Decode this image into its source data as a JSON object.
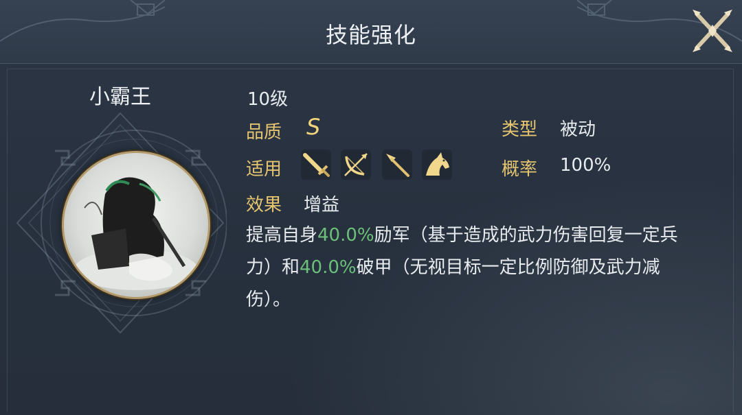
{
  "dialog": {
    "title": "技能强化",
    "close_icon": "close-x-icon"
  },
  "hero": {
    "name": "小霸王",
    "portrait": "hero-portrait-ink-warrior"
  },
  "skill": {
    "level": "10级",
    "quality_label": "品质",
    "quality_value": "S",
    "type_label": "类型",
    "type_value": "被动",
    "applicable_label": "适用",
    "applicable_icons": [
      "sword-icon",
      "bow-icon",
      "spear-icon",
      "horse-icon"
    ],
    "chance_label": "概率",
    "chance_value": "100%",
    "effect_label": "效果",
    "effect_value": "增益"
  },
  "description": {
    "p1": "提高自身",
    "v1": "40.0%",
    "p2": "励军（基于造成的武力伤害回复一定兵力）和",
    "v2": "40.0%",
    "p3": "破甲（无视目标一定比例防御及武力减伤）。"
  },
  "colors": {
    "label_gold": "#e6c570",
    "highlight_green": "#6cc07a",
    "quality_gold": "#f3d47a",
    "panel_bg": "#283240"
  }
}
